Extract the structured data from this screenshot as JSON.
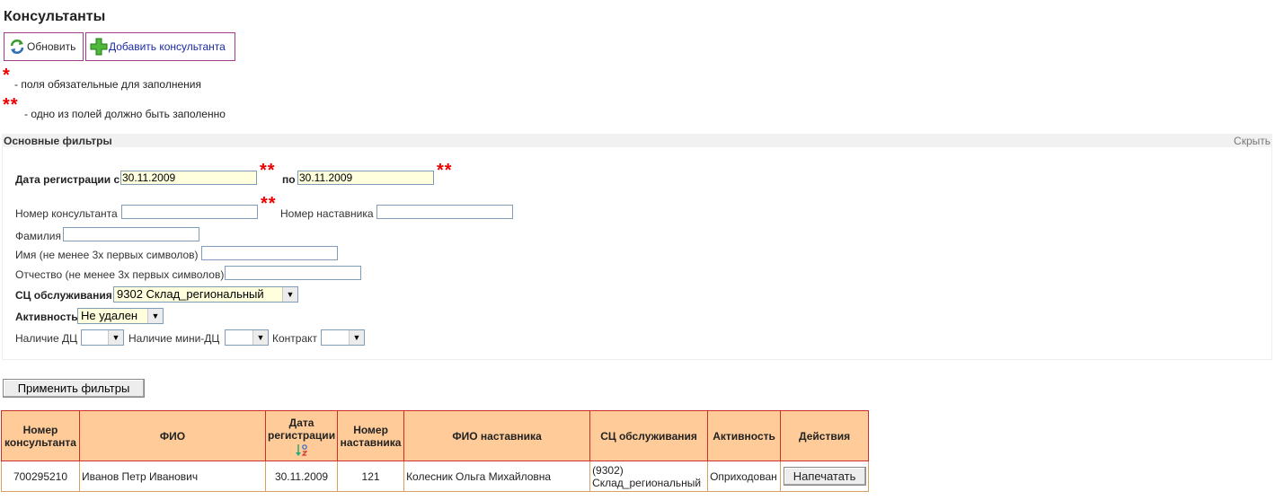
{
  "page": {
    "title": "Консультанты"
  },
  "toolbar": {
    "refresh_label": "Обновить",
    "add_label": "Добавить консультанта"
  },
  "legend": {
    "required_mark": "*",
    "required_text": "- поля обязательные для заполнения",
    "one_of_mark": "**",
    "one_of_text": "- одно из полей должно быть заполенно"
  },
  "filters": {
    "header": "Основные фильтры",
    "hide_label": "Скрыть",
    "reg_date_from_label": "Дата регистрации с",
    "reg_date_from": "30.11.2009",
    "reg_date_to_label": "по",
    "reg_date_to": "30.11.2009",
    "consultant_number_label": "Номер консультанта",
    "consultant_number": "",
    "mentor_number_label": "Номер наставника",
    "mentor_number": "",
    "surname_label": "Фамилия",
    "surname": "",
    "first_name_label": "Имя (не менее 3х первых символов)",
    "first_name": "",
    "patronymic_label": "Отчество (не менее 3х первых символов)",
    "patronymic": "",
    "service_center_label": "СЦ обслуживания",
    "service_center": "9302 Склад_региональный",
    "activity_label": "Активность",
    "activity": "Не удален",
    "dc_label": "Наличие ДЦ",
    "dc": "",
    "mini_dc_label": "Наличие мини-ДЦ",
    "mini_dc": "",
    "contract_label": "Контракт",
    "contract": "",
    "apply_label": "Применить фильтры"
  },
  "table": {
    "headers": {
      "number": "Номер консультанта",
      "fio": "ФИО",
      "reg_date": "Дата регистрации",
      "mentor_number": "Номер наставника",
      "mentor_fio": "ФИО наставника",
      "service_center": "СЦ обслуживания",
      "activity": "Активность",
      "actions": "Действия"
    },
    "rows": [
      {
        "number": "700295210",
        "fio": "Иванов Петр Иванович",
        "reg_date": "30.11.2009",
        "mentor_number": "121",
        "mentor_fio": "Колесник Ольга Михайловна",
        "service_center_code": "(9302)",
        "service_center_name": "Склад_региональный",
        "activity": "Оприходован",
        "action_label": "Напечатать"
      }
    ]
  },
  "colors": {
    "header_bg": "#ffcc99",
    "border": "#c8302e",
    "required_star": "#e00000",
    "input_highlight": "#ffffdd"
  }
}
